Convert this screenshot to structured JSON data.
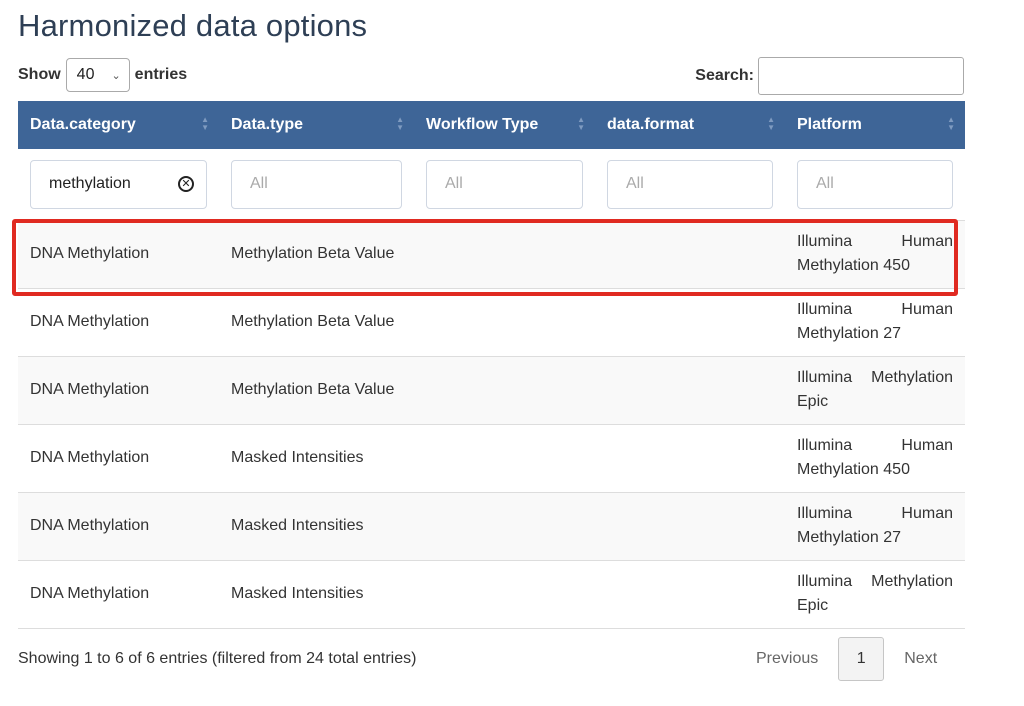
{
  "title": "Harmonized data options",
  "length": {
    "prefix": "Show",
    "value": "40",
    "suffix": "entries"
  },
  "search": {
    "label": "Search:",
    "value": ""
  },
  "columns": [
    "Data.category",
    "Data.type",
    "Workflow Type",
    "data.format",
    "Platform"
  ],
  "filters": {
    "category_value": "methylation",
    "placeholder": "All"
  },
  "rows": [
    {
      "category": "DNA Methylation",
      "type": "Methylation Beta Value",
      "workflow": "",
      "format": "",
      "platform": "Illumina Human Methylation 450"
    },
    {
      "category": "DNA Methylation",
      "type": "Methylation Beta Value",
      "workflow": "",
      "format": "",
      "platform": "Illumina Human Methylation 27"
    },
    {
      "category": "DNA Methylation",
      "type": "Methylation Beta Value",
      "workflow": "",
      "format": "",
      "platform": "Illumina Methylation Epic"
    },
    {
      "category": "DNA Methylation",
      "type": "Masked Intensities",
      "workflow": "",
      "format": "",
      "platform": "Illumina Human Methylation 450"
    },
    {
      "category": "DNA Methylation",
      "type": "Masked Intensities",
      "workflow": "",
      "format": "",
      "platform": "Illumina Human Methylation 27"
    },
    {
      "category": "DNA Methylation",
      "type": "Masked Intensities",
      "workflow": "",
      "format": "",
      "platform": "Illumina Methylation Epic"
    }
  ],
  "info": "Showing 1 to 6 of 6 entries (filtered from 24 total entries)",
  "pagination": {
    "previous": "Previous",
    "current": "1",
    "next": "Next"
  },
  "colors": {
    "header_bg": "#3e6597",
    "highlight": "#e02a21",
    "title": "#2e3f55"
  }
}
